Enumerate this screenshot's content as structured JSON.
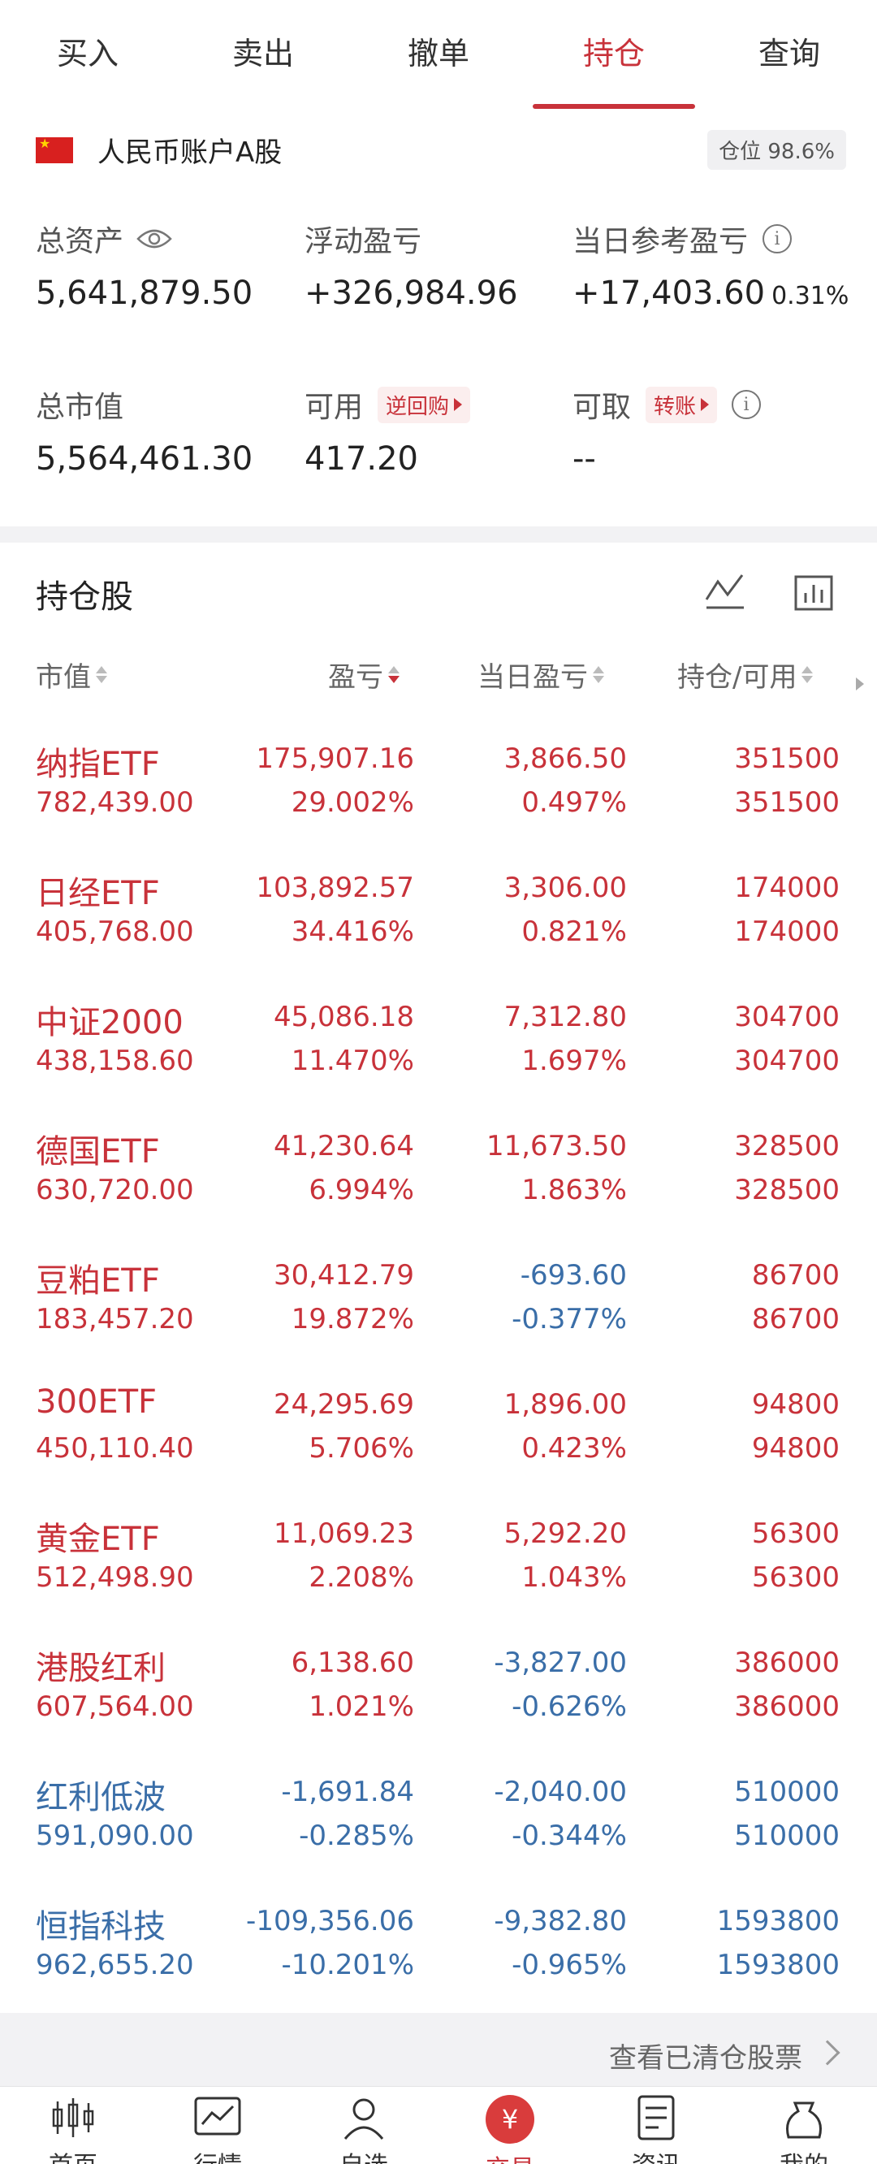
{
  "tabs": [
    {
      "label": "买入"
    },
    {
      "label": "卖出"
    },
    {
      "label": "撤单"
    },
    {
      "label": "持仓"
    },
    {
      "label": "查询"
    }
  ],
  "active_tab": "持仓",
  "account": {
    "name": "人民币账户A股",
    "position_badge": "仓位 98.6%",
    "total_assets_label": "总资产",
    "total_assets": "5,641,879.50",
    "floating_pnl_label": "浮动盈亏",
    "floating_pnl": "+326,984.96",
    "daily_pnl_label": "当日参考盈亏",
    "daily_pnl": "+17,403.60",
    "daily_pnl_pct": "0.31%",
    "market_value_label": "总市值",
    "market_value": "5,564,461.30",
    "available_label": "可用",
    "available": "417.20",
    "reverse_repo_label": "逆回购",
    "withdrawable_label": "可取",
    "withdrawable": "--",
    "transfer_label": "转账"
  },
  "holdings": {
    "title": "持仓股",
    "columns": {
      "market_value": "市值",
      "pnl": "盈亏",
      "daily_pnl": "当日盈亏",
      "holding": "持仓/可用"
    },
    "rows": [
      {
        "name": "纳指ETF",
        "market_value": "782,439.00",
        "pnl": "175,907.16",
        "pnl_pct": "29.002%",
        "daily": "3,866.50",
        "daily_pct": "0.497%",
        "holding": "351500",
        "available": "351500",
        "name_color": "red",
        "pnl_color": "red",
        "daily_color": "red"
      },
      {
        "name": "日经ETF",
        "market_value": "405,768.00",
        "pnl": "103,892.57",
        "pnl_pct": "34.416%",
        "daily": "3,306.00",
        "daily_pct": "0.821%",
        "holding": "174000",
        "available": "174000",
        "name_color": "red",
        "pnl_color": "red",
        "daily_color": "red"
      },
      {
        "name": "中证2000",
        "market_value": "438,158.60",
        "pnl": "45,086.18",
        "pnl_pct": "11.470%",
        "daily": "7,312.80",
        "daily_pct": "1.697%",
        "holding": "304700",
        "available": "304700",
        "name_color": "red",
        "pnl_color": "red",
        "daily_color": "red"
      },
      {
        "name": "德国ETF",
        "market_value": "630,720.00",
        "pnl": "41,230.64",
        "pnl_pct": "6.994%",
        "daily": "11,673.50",
        "daily_pct": "1.863%",
        "holding": "328500",
        "available": "328500",
        "name_color": "red",
        "pnl_color": "red",
        "daily_color": "red"
      },
      {
        "name": "豆粕ETF",
        "market_value": "183,457.20",
        "pnl": "30,412.79",
        "pnl_pct": "19.872%",
        "daily": "-693.60",
        "daily_pct": "-0.377%",
        "holding": "86700",
        "available": "86700",
        "name_color": "red",
        "pnl_color": "red",
        "daily_color": "blue"
      },
      {
        "name": "300ETF",
        "market_value": "450,110.40",
        "pnl": "24,295.69",
        "pnl_pct": "5.706%",
        "daily": "1,896.00",
        "daily_pct": "0.423%",
        "holding": "94800",
        "available": "94800",
        "name_color": "red",
        "pnl_color": "red",
        "daily_color": "red"
      },
      {
        "name": "黄金ETF",
        "market_value": "512,498.90",
        "pnl": "11,069.23",
        "pnl_pct": "2.208%",
        "daily": "5,292.20",
        "daily_pct": "1.043%",
        "holding": "56300",
        "available": "56300",
        "name_color": "red",
        "pnl_color": "red",
        "daily_color": "red"
      },
      {
        "name": "港股红利",
        "market_value": "607,564.00",
        "pnl": "6,138.60",
        "pnl_pct": "1.021%",
        "daily": "-3,827.00",
        "daily_pct": "-0.626%",
        "holding": "386000",
        "available": "386000",
        "name_color": "red",
        "pnl_color": "red",
        "daily_color": "blue"
      },
      {
        "name": "红利低波",
        "market_value": "591,090.00",
        "pnl": "-1,691.84",
        "pnl_pct": "-0.285%",
        "daily": "-2,040.00",
        "daily_pct": "-0.344%",
        "holding": "510000",
        "available": "510000",
        "name_color": "blue",
        "pnl_color": "blue",
        "daily_color": "blue"
      },
      {
        "name": "恒指科技",
        "market_value": "962,655.20",
        "pnl": "-109,356.06",
        "pnl_pct": "-10.201%",
        "daily": "-9,382.80",
        "daily_pct": "-0.965%",
        "holding": "1593800",
        "available": "1593800",
        "name_color": "blue",
        "pnl_color": "blue",
        "daily_color": "blue"
      }
    ],
    "cleared_link": "查看已清仓股票"
  },
  "nav": [
    {
      "label": "首页",
      "icon": "candlestick-icon"
    },
    {
      "label": "行情",
      "icon": "chart-icon"
    },
    {
      "label": "自选",
      "icon": "user-icon"
    },
    {
      "label": "交易",
      "icon": "yen-icon"
    },
    {
      "label": "资讯",
      "icon": "document-icon"
    },
    {
      "label": "我的",
      "icon": "bag-icon"
    }
  ],
  "colors": {
    "up": "#c8323a",
    "down": "#3a6ea8",
    "accent": "#d93c3c"
  }
}
